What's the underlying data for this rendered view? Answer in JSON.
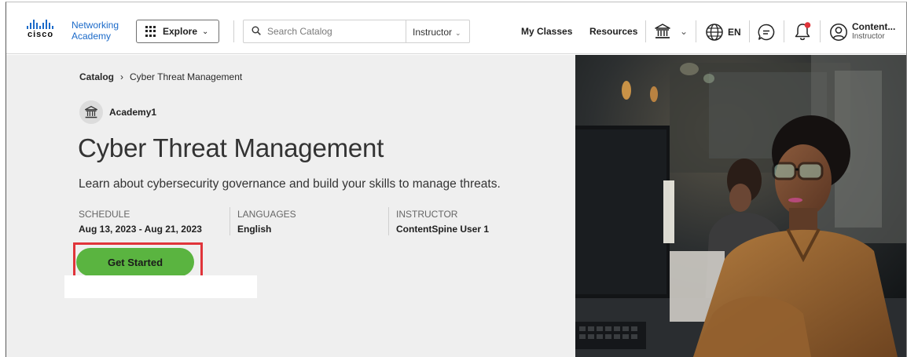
{
  "header": {
    "logo": {
      "brand": "cisco",
      "line1": "Networking",
      "line2": "Academy"
    },
    "explore_label": "Explore",
    "search": {
      "placeholder": "Search Catalog",
      "role_label": "Instructor"
    },
    "nav": {
      "my_classes": "My Classes",
      "resources": "Resources"
    },
    "language": "EN",
    "user": {
      "name": "Content...",
      "role": "Instructor"
    },
    "icons": [
      "grid-icon",
      "chevron-down-icon",
      "search-icon",
      "institution-icon",
      "globe-icon",
      "chat-icon",
      "bell-icon",
      "user-icon"
    ],
    "notification_dot_color": "#e0343a"
  },
  "breadcrumb": {
    "root": "Catalog",
    "current": "Cyber Threat Management"
  },
  "course": {
    "academy": "Academy1",
    "title": "Cyber Threat Management",
    "description": "Learn about cybersecurity governance and build your skills to manage threats.",
    "schedule_label": "SCHEDULE",
    "schedule_value": "Aug 13, 2023 - Aug 21, 2023",
    "languages_label": "LANGUAGES",
    "languages_value": "English",
    "instructor_label": "INSTRUCTOR",
    "instructor_value": "ContentSpine User 1",
    "cta_label": "Get Started"
  },
  "colors": {
    "accent_green": "#5ab440",
    "link_blue": "#1b6ac9",
    "highlight_red": "#e0343a",
    "hero_bg": "#efefef"
  }
}
